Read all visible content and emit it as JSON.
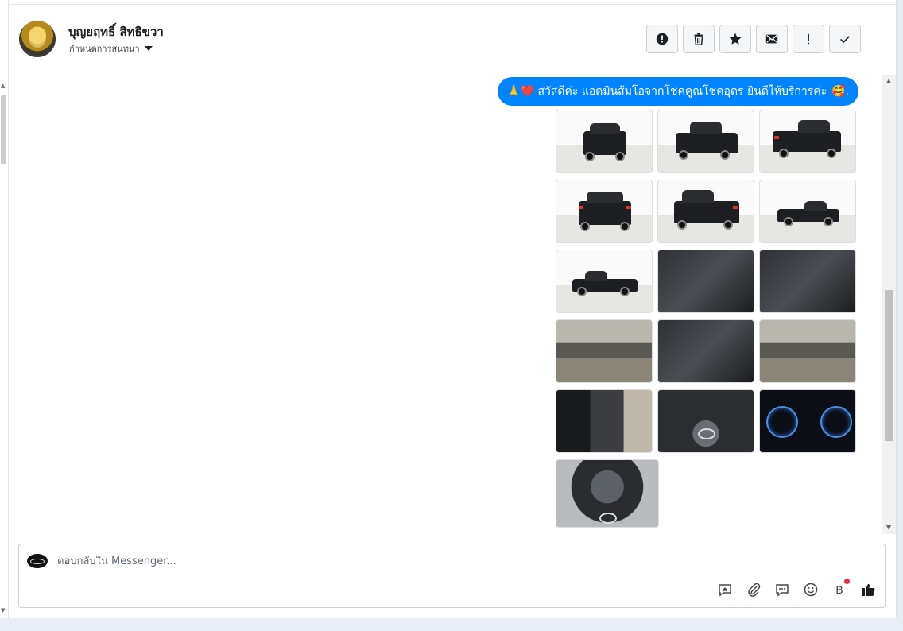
{
  "header": {
    "contact_name": "บุญยฤทธิ์ สิทธิขวา",
    "assign_label": "กำหนดการสนทนา",
    "actions": [
      {
        "icon": "alert-circle-icon",
        "label": "Mark as spam"
      },
      {
        "icon": "trash-icon",
        "label": "Delete"
      },
      {
        "icon": "star-icon",
        "label": "Star"
      },
      {
        "icon": "envelope-icon",
        "label": "Mark as unread"
      },
      {
        "icon": "exclamation-icon",
        "label": "Follow up"
      },
      {
        "icon": "checkmark-icon",
        "label": "Mark as done"
      }
    ]
  },
  "message": {
    "lead_emoji": "🙏❤️",
    "text": "สวัสดีค่ะ แอดมินส้มโอจากโชคคูณโชคอุดร ยินดีให้บริการค่ะ",
    "trail_emoji": "🥰."
  },
  "photos": [
    "truck-front",
    "truck-front-three-quarter",
    "truck-rear-three-quarter",
    "truck-rear",
    "truck-rear-three-quarter-left",
    "truck-side-right",
    "truck-side-left",
    "gear-shifter",
    "dashboard-passenger-view",
    "front-seats-driver-door",
    "interior-dashboard-wide",
    "rear-seats-view",
    "door-panel",
    "steering-wheel",
    "instrument-cluster",
    "engine-bay"
  ],
  "composer": {
    "placeholder": "ตอบกลับใน Messenger...",
    "currency_symbol": "฿",
    "tools": [
      "saved-reply-icon",
      "attachment-icon",
      "chat-bubble-icon",
      "emoji-icon",
      "payment-icon",
      "thumbs-up-icon"
    ]
  }
}
